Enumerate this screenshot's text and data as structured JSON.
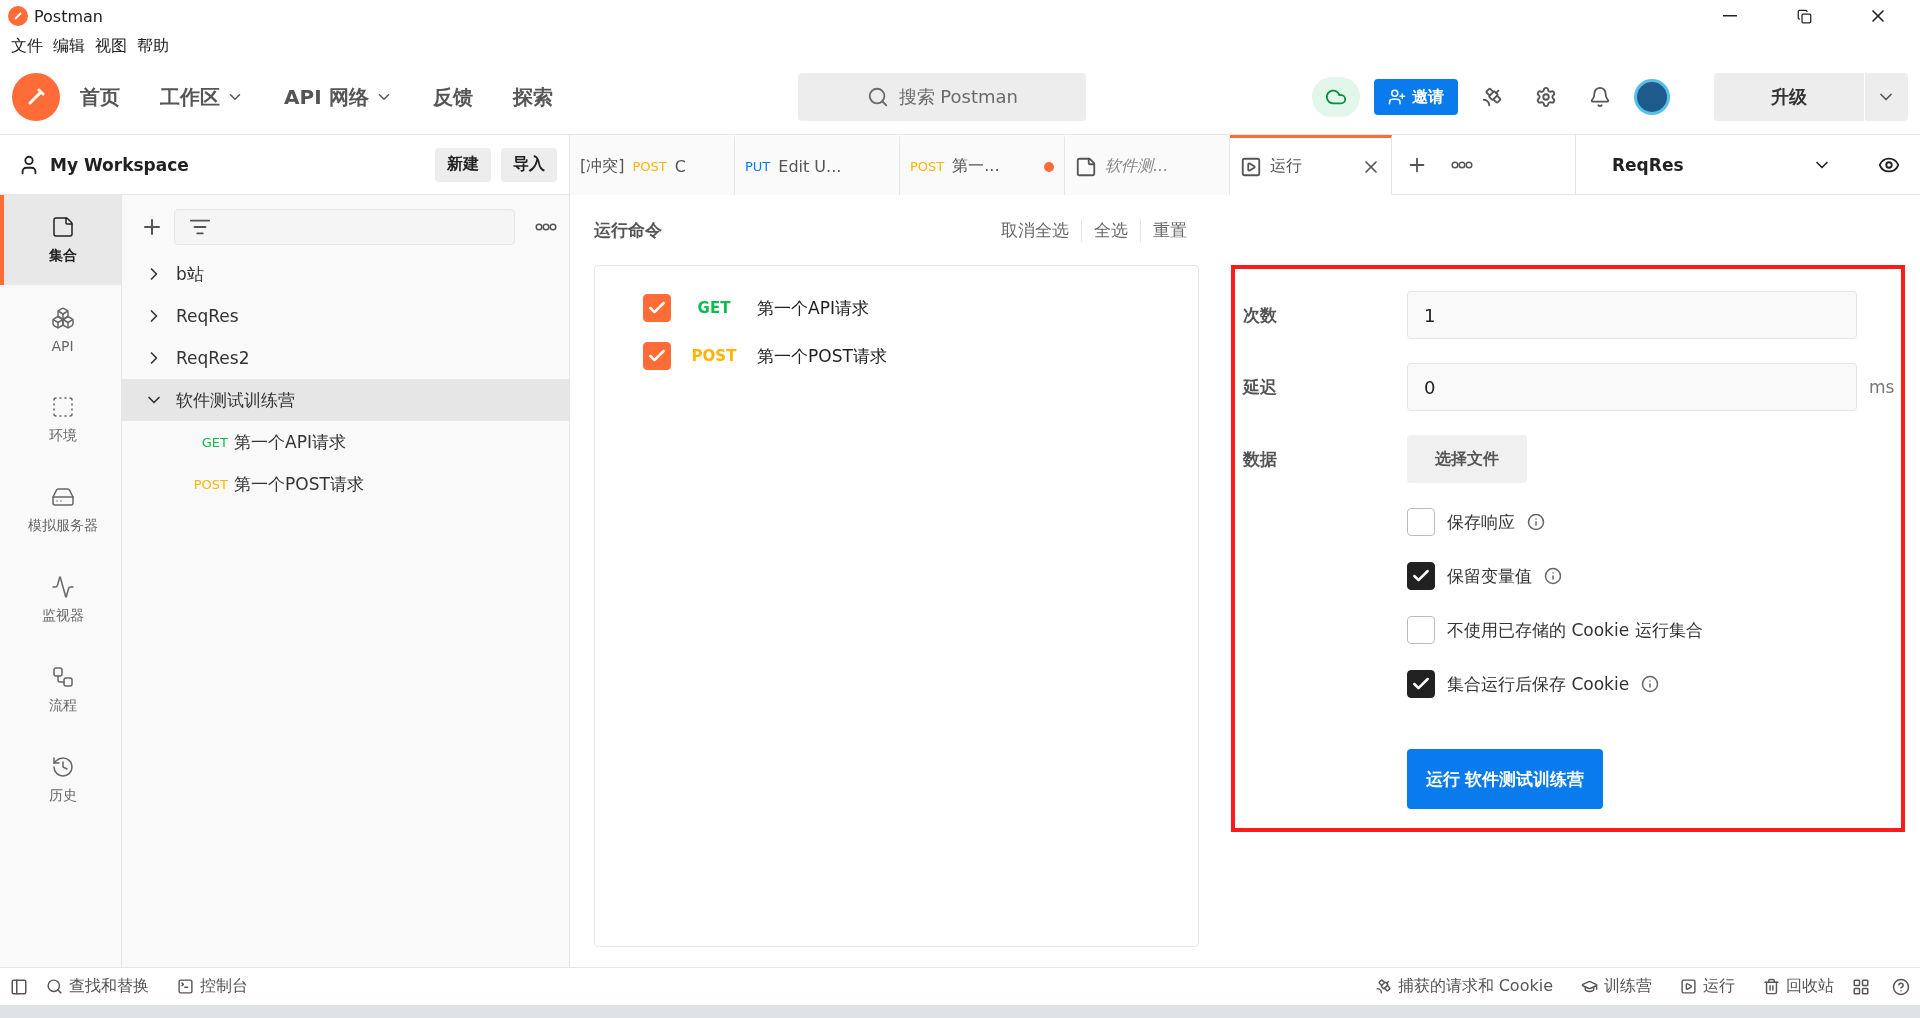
{
  "window": {
    "title": "Postman"
  },
  "menu": [
    "文件",
    "编辑",
    "视图",
    "帮助"
  ],
  "nav": [
    {
      "label": "首页",
      "dropdown": false
    },
    {
      "label": "工作区",
      "dropdown": true
    },
    {
      "label": "API 网络",
      "dropdown": true
    },
    {
      "label": "反馈",
      "dropdown": false
    },
    {
      "label": "探索",
      "dropdown": false
    }
  ],
  "search": {
    "placeholder": "搜索 Postman"
  },
  "invite_button": "邀请",
  "upgrade_button": "升级",
  "workspace": {
    "name": "My Workspace",
    "buttons": [
      "新建",
      "导入"
    ]
  },
  "tabs": [
    {
      "kind": "request",
      "prefix": "[冲突]",
      "method": "POST",
      "color": "#ffb400",
      "label": "C",
      "unsaved": false,
      "selected": false
    },
    {
      "kind": "request",
      "method": "PUT",
      "color": "#097bed",
      "label": "Edit U...",
      "unsaved": false,
      "selected": false
    },
    {
      "kind": "request",
      "method": "POST",
      "color": "#ffb400",
      "label": "第一...",
      "unsaved": true,
      "selected": false
    },
    {
      "kind": "collection",
      "label": "软件测...",
      "unsaved": false,
      "selected": false
    },
    {
      "kind": "runner",
      "label": "运行",
      "unsaved": false,
      "selected": true
    }
  ],
  "environment": "ReqRes",
  "sidebar": {
    "items": [
      {
        "label": "集合",
        "selected": true
      },
      {
        "label": "API",
        "selected": false
      },
      {
        "label": "环境",
        "selected": false
      },
      {
        "label": "模拟服务器",
        "selected": false
      },
      {
        "label": "监视器",
        "selected": false
      },
      {
        "label": "流程",
        "selected": false
      },
      {
        "label": "历史",
        "selected": false
      }
    ]
  },
  "tree": [
    {
      "label": "b站",
      "expanded": false,
      "selected": false
    },
    {
      "label": "ReqRes",
      "expanded": false,
      "selected": false
    },
    {
      "label": "ReqRes2",
      "expanded": false,
      "selected": false
    },
    {
      "label": "软件测试训练营",
      "expanded": true,
      "selected": true,
      "children": [
        {
          "method": "GET",
          "color": "#0cbb52",
          "label": "第一个API请求"
        },
        {
          "method": "POST",
          "color": "#ffb400",
          "label": "第一个POST请求"
        }
      ]
    }
  ],
  "run_order": {
    "title": "运行命令",
    "actions": [
      "取消全选",
      "全选",
      "重置"
    ],
    "requests": [
      {
        "checked": true,
        "method": "GET",
        "color": "#0cbb52",
        "label": "第一个API请求"
      },
      {
        "checked": true,
        "method": "POST",
        "color": "#ffb400",
        "label": "第一个POST请求"
      }
    ]
  },
  "run_settings": {
    "highlighted": true,
    "fields": [
      {
        "label": "次数",
        "value": "1"
      },
      {
        "label": "延迟",
        "value": "0",
        "unit": "ms"
      }
    ],
    "data": {
      "label": "数据",
      "button": "选择文件"
    },
    "options": [
      {
        "label": "保存响应",
        "checked": false,
        "info": true
      },
      {
        "label": "保留变量值",
        "checked": true,
        "info": true
      },
      {
        "label": "不使用已存储的 Cookie 运行集合",
        "checked": false,
        "info": false
      },
      {
        "label": "集合运行后保存 Cookie",
        "checked": true,
        "info": true
      }
    ],
    "run_button": "运行 软件测试训练营"
  },
  "status_bar": {
    "left": [
      "查找和替换",
      "控制台"
    ],
    "right": [
      "捕获的请求和 Cookie",
      "训练营",
      "运行",
      "回收站"
    ]
  }
}
